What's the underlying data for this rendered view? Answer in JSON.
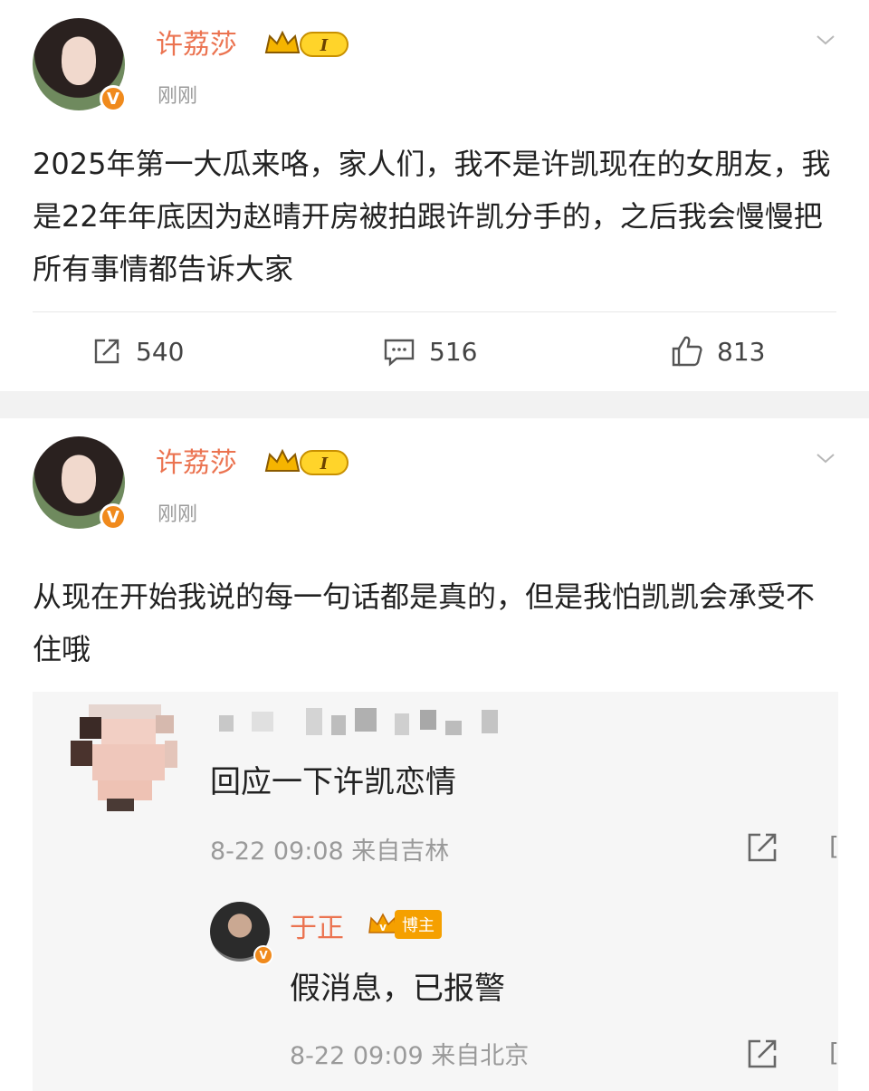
{
  "post1": {
    "username": "许荔莎",
    "level_badge": "I",
    "time": "刚刚",
    "verified_mark": "V",
    "text": "2025年第一大瓜来咯，家人们，我不是许凯现在的女朋友，我是22年年底因为赵晴开房被拍跟许凯分手的，之后我会慢慢把所有事情都告诉大家",
    "actions": {
      "repost_count": "540",
      "comment_count": "516",
      "like_count": "813"
    }
  },
  "post2": {
    "username": "许荔莎",
    "level_badge": "I",
    "time": "刚刚",
    "verified_mark": "V",
    "text": "从现在开始我说的每一句话都是真的，但是我怕凯凯会承受不住哦",
    "comment": {
      "text": "回应一下许凯恋情",
      "meta": "8-22 09:08 来自吉林",
      "cut_glyph": "[",
      "reply": {
        "name": "于正",
        "badge": "博主",
        "text": "假消息，已报警",
        "meta": "8-22 09:09 来自北京",
        "cut_glyph": "["
      }
    }
  },
  "icons": {
    "repost": "repost-icon",
    "comment": "comment-icon",
    "like": "thumbs-up-icon",
    "more": "chevron-down-icon",
    "share": "share-icon",
    "crown": "crown-icon"
  },
  "colors": {
    "username": "#eb7350",
    "verified": "#f08a1c",
    "meta": "#9a9a9a",
    "separator": "#f2f2f2",
    "comment_bg": "#f6f6f6"
  }
}
